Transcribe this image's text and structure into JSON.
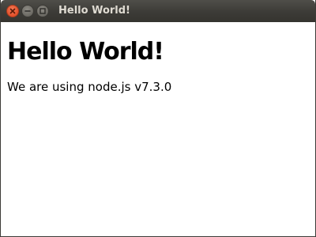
{
  "window": {
    "title": "Hello World!"
  },
  "page": {
    "heading": "Hello World!",
    "text": "We are using node.js v7.3.0"
  },
  "icons": {
    "close": "close-icon",
    "minimize": "minimize-icon",
    "maximize": "maximize-icon"
  },
  "colors": {
    "titlebar": "#3c3b37",
    "title_text": "#dfdbd2",
    "close_button": "#e2502b",
    "window_button": "#6b6963",
    "content_background": "#ffffff",
    "text": "#000000"
  }
}
